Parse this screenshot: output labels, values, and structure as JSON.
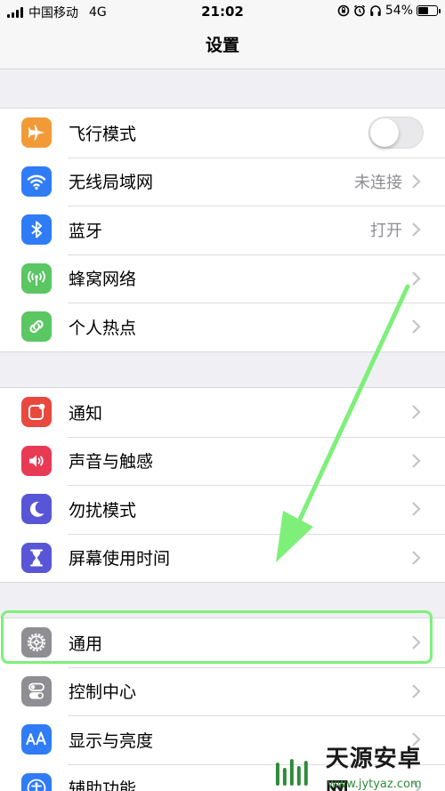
{
  "status_bar": {
    "carrier": "中国移动",
    "network": "4G",
    "time": "21:02",
    "battery_percent": "54%",
    "battery_level": 0.54,
    "icons": [
      "rotation-lock-icon",
      "alarm-icon",
      "headphones-icon"
    ]
  },
  "nav": {
    "title": "设置"
  },
  "groups": [
    [
      {
        "label": "飞行模式",
        "icon": "airplane-icon",
        "color": "#f29a38",
        "control": "toggle",
        "toggle_on": false
      },
      {
        "label": "无线局域网",
        "icon": "wifi-icon",
        "color": "#2f7cf6",
        "value": "未连接"
      },
      {
        "label": "蓝牙",
        "icon": "bluetooth-icon",
        "color": "#2f7cf6",
        "value": "打开"
      },
      {
        "label": "蜂窝网络",
        "icon": "antenna-icon",
        "color": "#5ac763"
      },
      {
        "label": "个人热点",
        "icon": "hotspot-icon",
        "color": "#5ac763"
      }
    ],
    [
      {
        "label": "通知",
        "icon": "notification-icon",
        "color": "#e9483e"
      },
      {
        "label": "声音与触感",
        "icon": "speaker-icon",
        "color": "#e93a55"
      },
      {
        "label": "勿扰模式",
        "icon": "moon-icon",
        "color": "#5856d6"
      },
      {
        "label": "屏幕使用时间",
        "icon": "hourglass-icon",
        "color": "#5856d6"
      }
    ],
    [
      {
        "label": "通用",
        "icon": "gear-icon",
        "color": "#8e8e93"
      },
      {
        "label": "控制中心",
        "icon": "toggles-icon",
        "color": "#8e8e93"
      },
      {
        "label": "显示与亮度",
        "icon": "text-size-icon",
        "color": "#2f7cf6"
      },
      {
        "label": "辅助功能",
        "icon": "accessibility-icon",
        "color": "#2f7cf6"
      }
    ]
  ],
  "annotation": {
    "color": "#7ef07a"
  },
  "watermark": {
    "title": "天源安卓网",
    "url": "www.jytyaz.com"
  }
}
